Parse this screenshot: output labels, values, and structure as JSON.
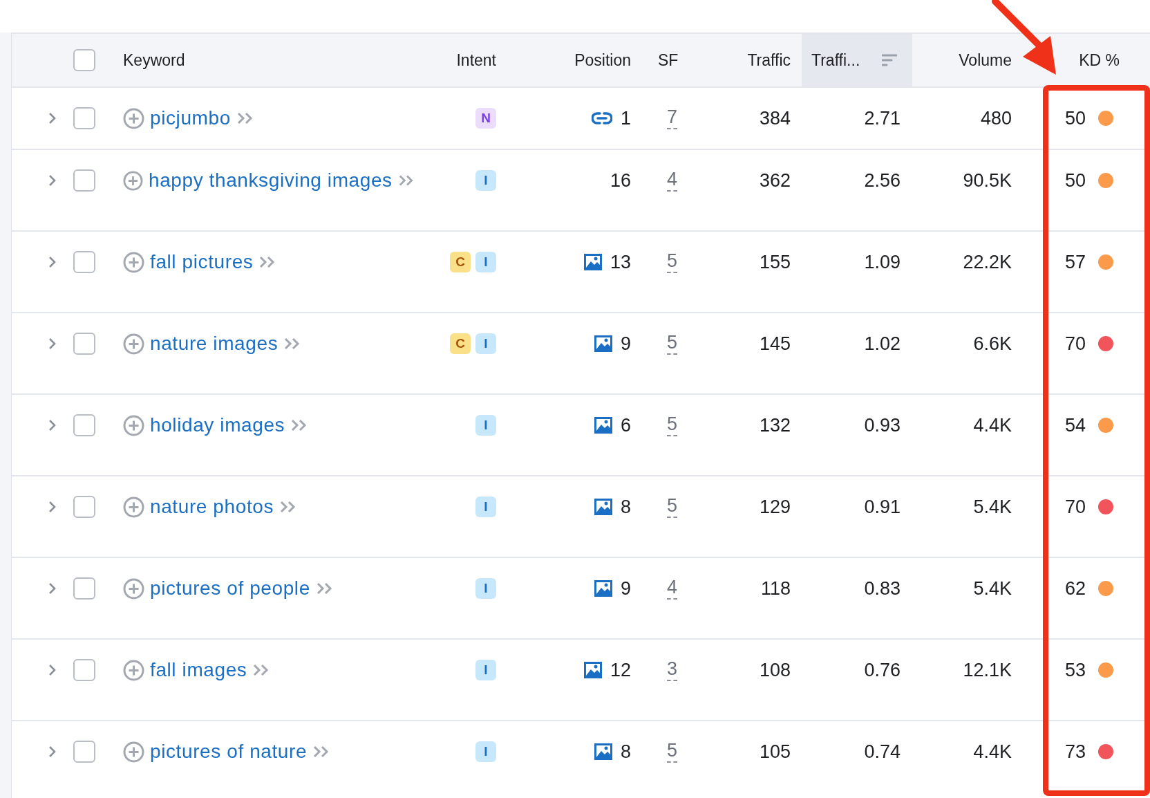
{
  "table": {
    "select_all": {
      "checked": false
    },
    "columns": [
      {
        "label": "Keyword",
        "sorted": false
      },
      {
        "label": "Intent",
        "sorted": false
      },
      {
        "label": "Position",
        "sorted": false
      },
      {
        "label": "SF",
        "sorted": false
      },
      {
        "label": "Traffic",
        "sorted": false
      },
      {
        "label": "Traffi...",
        "sorted": true
      },
      {
        "label": "Volume",
        "sorted": false
      },
      {
        "label": "KD %",
        "sorted": false
      }
    ],
    "rows": [
      {
        "checked": false,
        "keyword": "picjumbo",
        "intents": [
          {
            "label": "N",
            "kind": "navigational"
          }
        ],
        "position": {
          "kind": "link",
          "value": "1"
        },
        "sf": "7",
        "traffic": "384",
        "traffic_pct": "2.71",
        "volume": "480",
        "kd": {
          "value": "50",
          "color": "#fb9a4b"
        }
      },
      {
        "checked": false,
        "keyword": "happy thanksgiving images",
        "intents": [
          {
            "label": "I",
            "kind": "informational"
          }
        ],
        "position": {
          "value": "16"
        },
        "sf": "4",
        "traffic": "362",
        "traffic_pct": "2.56",
        "volume": "90.5K",
        "kd": {
          "value": "50",
          "color": "#fb9a4b"
        }
      },
      {
        "checked": false,
        "keyword": "fall pictures",
        "intents": [
          {
            "label": "C",
            "kind": "commercial"
          },
          {
            "label": "I",
            "kind": "informational"
          }
        ],
        "position": {
          "kind": "image",
          "value": "13"
        },
        "sf": "5",
        "traffic": "155",
        "traffic_pct": "1.09",
        "volume": "22.2K",
        "kd": {
          "value": "57",
          "color": "#fb9a4b"
        }
      },
      {
        "checked": false,
        "keyword": "nature images",
        "intents": [
          {
            "label": "C",
            "kind": "commercial"
          },
          {
            "label": "I",
            "kind": "informational"
          }
        ],
        "position": {
          "kind": "image",
          "value": "9"
        },
        "sf": "5",
        "traffic": "145",
        "traffic_pct": "1.02",
        "volume": "6.6K",
        "kd": {
          "value": "70",
          "color": "#f2545b"
        }
      },
      {
        "checked": false,
        "keyword": "holiday images",
        "intents": [
          {
            "label": "I",
            "kind": "informational"
          }
        ],
        "position": {
          "kind": "image",
          "value": "6"
        },
        "sf": "5",
        "traffic": "132",
        "traffic_pct": "0.93",
        "volume": "4.4K",
        "kd": {
          "value": "54",
          "color": "#fb9a4b"
        }
      },
      {
        "checked": false,
        "keyword": "nature photos",
        "intents": [
          {
            "label": "I",
            "kind": "informational"
          }
        ],
        "position": {
          "kind": "image",
          "value": "8"
        },
        "sf": "5",
        "traffic": "129",
        "traffic_pct": "0.91",
        "volume": "5.4K",
        "kd": {
          "value": "70",
          "color": "#f2545b"
        }
      },
      {
        "checked": false,
        "keyword": "pictures of people",
        "intents": [
          {
            "label": "I",
            "kind": "informational"
          }
        ],
        "position": {
          "kind": "image",
          "value": "9"
        },
        "sf": "4",
        "traffic": "118",
        "traffic_pct": "0.83",
        "volume": "5.4K",
        "kd": {
          "value": "62",
          "color": "#fb9a4b"
        }
      },
      {
        "checked": false,
        "keyword": "fall images",
        "intents": [
          {
            "label": "I",
            "kind": "informational"
          }
        ],
        "position": {
          "kind": "image",
          "value": "12"
        },
        "sf": "3",
        "traffic": "108",
        "traffic_pct": "0.76",
        "volume": "12.1K",
        "kd": {
          "value": "53",
          "color": "#fb9a4b"
        }
      },
      {
        "checked": false,
        "keyword": "pictures of nature",
        "intents": [
          {
            "label": "I",
            "kind": "informational"
          }
        ],
        "position": {
          "kind": "image",
          "value": "8"
        },
        "sf": "5",
        "traffic": "105",
        "traffic_pct": "0.74",
        "volume": "4.4K",
        "kd": {
          "value": "73",
          "color": "#f2545b"
        }
      }
    ]
  }
}
